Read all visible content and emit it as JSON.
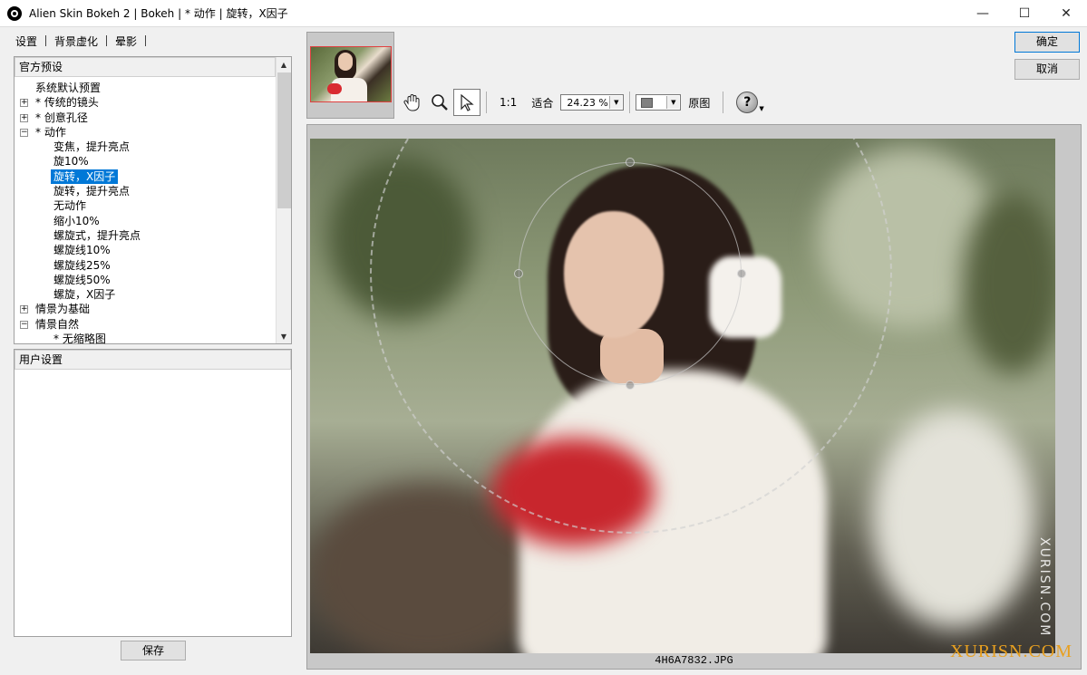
{
  "window": {
    "title": "Alien Skin Bokeh 2 | Bokeh | * 动作 | 旋转，X因子",
    "minimize_icon": "minimize-icon",
    "maximize_icon": "maximize-icon",
    "close_icon": "close-icon"
  },
  "left_tabs": [
    "设置",
    "背景虚化",
    "晕影"
  ],
  "presets": {
    "header": "官方预设",
    "items": [
      {
        "label": "系统默认预置",
        "level": 0,
        "expander": ""
      },
      {
        "label": "* 传统的镜头",
        "level": 0,
        "expander": "+"
      },
      {
        "label": "* 创意孔径",
        "level": 0,
        "expander": "+"
      },
      {
        "label": "* 动作",
        "level": 0,
        "expander": "−"
      },
      {
        "label": "变焦，提升亮点",
        "level": 1,
        "expander": ""
      },
      {
        "label": "旋10%",
        "level": 1,
        "expander": ""
      },
      {
        "label": "旋转，X因子",
        "level": 1,
        "expander": "",
        "selected": true
      },
      {
        "label": "旋转，提升亮点",
        "level": 1,
        "expander": ""
      },
      {
        "label": "无动作",
        "level": 1,
        "expander": ""
      },
      {
        "label": "缩小10%",
        "level": 1,
        "expander": ""
      },
      {
        "label": "螺旋式，提升亮点",
        "level": 1,
        "expander": ""
      },
      {
        "label": "螺旋线10%",
        "level": 1,
        "expander": ""
      },
      {
        "label": "螺旋线25%",
        "level": 1,
        "expander": ""
      },
      {
        "label": "螺旋线50%",
        "level": 1,
        "expander": ""
      },
      {
        "label": "螺旋，X因子",
        "level": 1,
        "expander": ""
      },
      {
        "label": "情景为基础",
        "level": 0,
        "expander": "+"
      },
      {
        "label": "情景自然",
        "level": 0,
        "expander": "−"
      },
      {
        "label": "* 无缩略图",
        "level": 1,
        "expander": ""
      }
    ]
  },
  "user_settings": {
    "header": "用户设置"
  },
  "save_button": "保存",
  "ok_button": "确定",
  "cancel_button": "取消",
  "toolbar": {
    "one_to_one": "1:1",
    "fit": "适合",
    "zoom_value": "24.23 %",
    "original": "原图",
    "help": "?"
  },
  "preview": {
    "filename": "4H6A7832.JPG",
    "watermark_vertical": "XURISN.COM",
    "watermark_horizontal": "XURISN.COM"
  },
  "colors": {
    "selection": "#0078d7",
    "background_swatch": "#808080"
  }
}
